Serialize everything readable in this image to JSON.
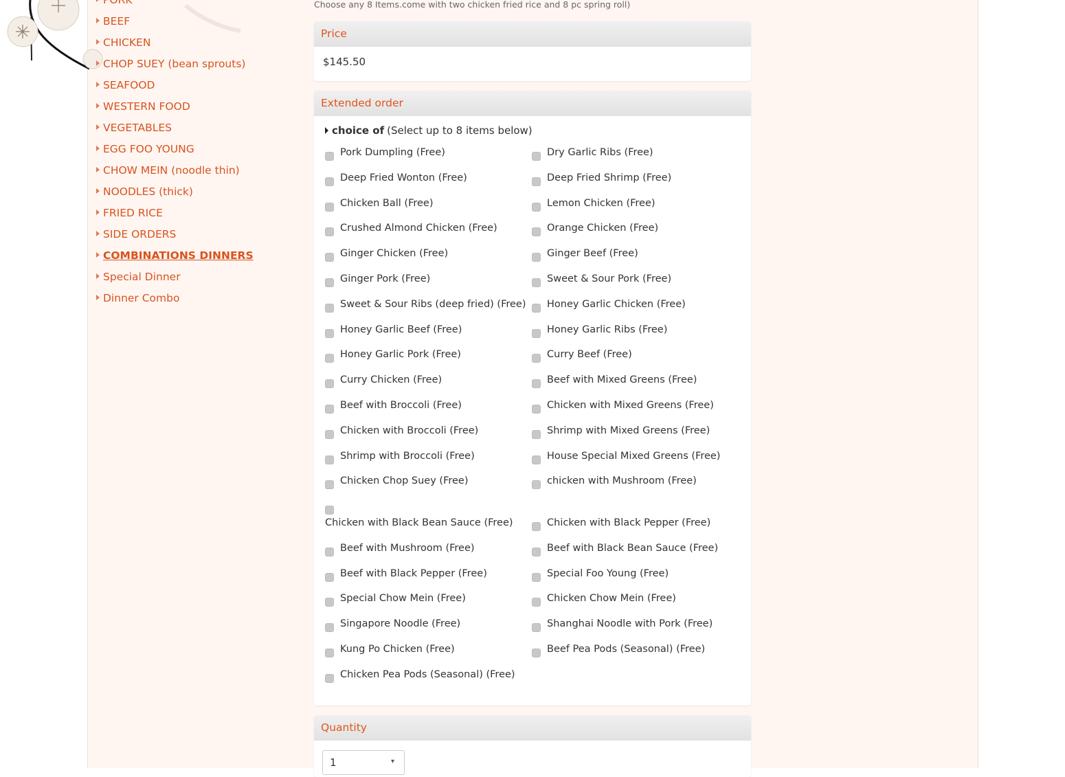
{
  "page": {
    "subtitle": "Choose any 8 Items.come with two chicken fried rice and 8 pc spring roll)"
  },
  "colors": {
    "accent": "#d9531e",
    "panel_bg": "#fff6f2",
    "header_bg": "#e6e6e6"
  },
  "sidebar": {
    "items": [
      {
        "label": "PORK",
        "active": false
      },
      {
        "label": "BEEF",
        "active": false
      },
      {
        "label": "CHICKEN",
        "active": false
      },
      {
        "label": "CHOP SUEY (bean sprouts)",
        "active": false
      },
      {
        "label": "SEAFOOD",
        "active": false
      },
      {
        "label": "WESTERN FOOD",
        "active": false
      },
      {
        "label": "VEGETABLES",
        "active": false
      },
      {
        "label": "EGG FOO YOUNG",
        "active": false
      },
      {
        "label": "CHOW MEIN (noodle thin)",
        "active": false
      },
      {
        "label": "NOODLES (thick)",
        "active": false
      },
      {
        "label": "FRIED RICE",
        "active": false
      },
      {
        "label": "SIDE ORDERS",
        "active": false
      },
      {
        "label": "COMBINATIONS DINNERS",
        "active": true
      },
      {
        "label": "Special Dinner",
        "active": false
      },
      {
        "label": "Dinner Combo",
        "active": false
      }
    ]
  },
  "price": {
    "header": "Price",
    "value": "$145.50"
  },
  "extended": {
    "header": "Extended order",
    "choice_bold": "choice of",
    "choice_note": "(Select up to 8 items below)",
    "options": [
      "Pork Dumpling (Free)",
      "Dry Garlic Ribs (Free)",
      "Deep Fried Wonton (Free)",
      "Deep Fried Shrimp (Free)",
      "Chicken Ball (Free)",
      "Lemon Chicken (Free)",
      "Crushed Almond Chicken (Free)",
      "Orange Chicken (Free)",
      "Ginger Chicken (Free)",
      "Ginger Beef (Free)",
      "Ginger Pork (Free)",
      "Sweet & Sour Pork (Free)",
      "Sweet & Sour Ribs (deep fried) (Free)",
      "Honey Garlic Chicken (Free)",
      "Honey Garlic Beef (Free)",
      "Honey Garlic Ribs (Free)",
      "Honey Garlic Pork (Free)",
      "Curry Beef (Free)",
      "Curry Chicken (Free)",
      "Beef with Mixed Greens (Free)",
      "Beef with Broccoli (Free)",
      "Chicken with Mixed Greens (Free)",
      "Chicken with Broccoli (Free)",
      "Shrimp with Mixed Greens (Free)",
      "Shrimp with Broccoli (Free)",
      "House Special Mixed Greens (Free)",
      "Chicken Chop Suey (Free)",
      "chicken with Mushroom (Free)",
      "Chicken with Black Bean Sauce (Free)",
      "Chicken with Black Pepper (Free)",
      "Beef with Mushroom (Free)",
      "Beef with Black Bean Sauce (Free)",
      "Beef with Black Pepper (Free)",
      "Special Foo Young (Free)",
      "Special Chow Mein (Free)",
      "Chicken Chow Mein (Free)",
      "Singapore Noodle (Free)",
      "Shanghai Noodle with Pork (Free)",
      "Kung Po Chicken (Free)",
      "Beef Pea Pods (Seasonal) (Free)",
      "Chicken Pea Pods (Seasonal) (Free)"
    ]
  },
  "quantity": {
    "header": "Quantity",
    "value": "1"
  }
}
